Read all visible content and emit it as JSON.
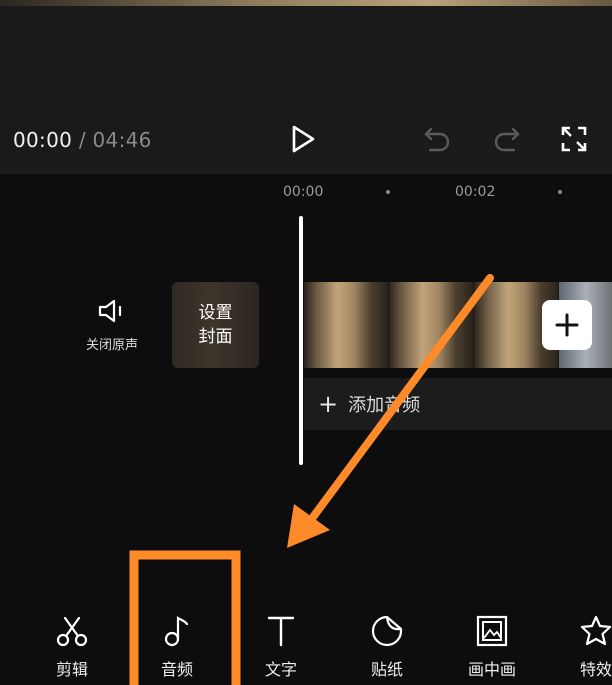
{
  "player": {
    "current_time": "00:00",
    "separator": "/",
    "total_time": "04:46",
    "controls": [
      "play-icon",
      "undo-icon",
      "redo-icon",
      "fullscreen-icon"
    ]
  },
  "timeline": {
    "ticks": [
      "00:00",
      "00:02"
    ],
    "mute_label": "关闭原声",
    "cover_label_line1": "设置",
    "cover_label_line2": "封面",
    "add_clip_icon": "plus-icon",
    "add_audio_label": "添加音频",
    "add_audio_plus": "+"
  },
  "toolbar": {
    "items": [
      {
        "label": "剪辑",
        "icon": "scissors-icon"
      },
      {
        "label": "音频",
        "icon": "music-note-icon"
      },
      {
        "label": "文字",
        "icon": "text-icon"
      },
      {
        "label": "贴纸",
        "icon": "sticker-icon"
      },
      {
        "label": "画中画",
        "icon": "picture-in-picture-icon"
      },
      {
        "label": "特效",
        "icon": "effects-star-icon"
      }
    ]
  },
  "annotation": {
    "highlight_color": "#ff8a2a"
  }
}
